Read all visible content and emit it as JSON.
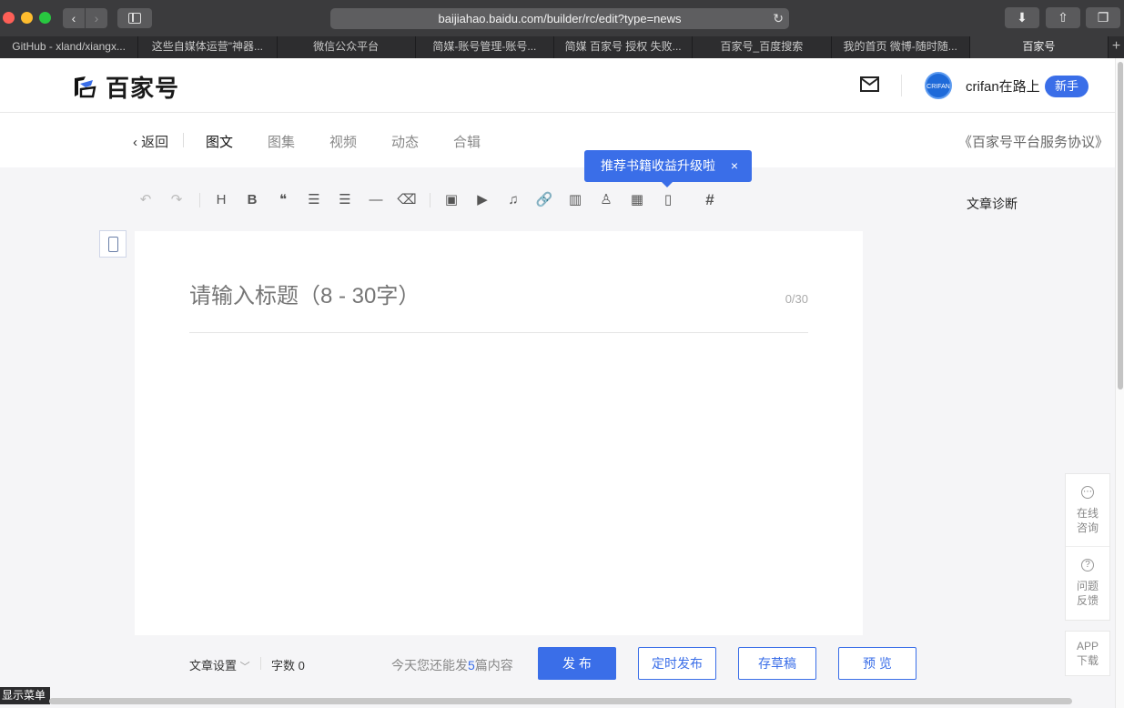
{
  "browser": {
    "url": "baijiahao.baidu.com/builder/rc/edit?type=news",
    "tabs": [
      {
        "label": "GitHub - xland/xiangx..."
      },
      {
        "label": "这些自媒体运营\"神器..."
      },
      {
        "label": "微信公众平台"
      },
      {
        "label": "简媒-账号管理-账号..."
      },
      {
        "label": "简媒 百家号 授权 失败..."
      },
      {
        "label": "百家号_百度搜索"
      },
      {
        "label": "我的首页 微博-随时随..."
      },
      {
        "label": "百家号"
      }
    ],
    "new_tab": "+"
  },
  "header": {
    "logo_text": "百家号",
    "username": "crifan在路上",
    "avatar_text": "CRIFAN",
    "newbie_badge": "新手"
  },
  "subnav": {
    "back": "返回",
    "tabs": [
      {
        "label": "图文"
      },
      {
        "label": "图集"
      },
      {
        "label": "视频"
      },
      {
        "label": "动态"
      },
      {
        "label": "合辑"
      }
    ],
    "agreement": "《百家号平台服务协议》"
  },
  "tooltip": {
    "text": "推荐书籍收益升级啦",
    "close": "×"
  },
  "toolbar": {
    "icons": [
      "undo-icon",
      "redo-icon",
      "heading-icon",
      "bold-icon",
      "quote-icon",
      "ordered-list-icon",
      "bullet-list-icon",
      "divider-icon",
      "clear-format-icon",
      "image-icon",
      "video-icon",
      "audio-icon",
      "link-icon",
      "chart-icon",
      "user-card-icon",
      "table-icon",
      "book-icon",
      "hashtag-icon"
    ],
    "glyphs": {
      "undo": "↶",
      "redo": "↷",
      "heading": "H",
      "bold": "B",
      "quote": "❝",
      "ordered": "☰",
      "bullet": "☰",
      "divider": "—",
      "eraser": "⌫",
      "image": "▣",
      "video": "▶",
      "audio": "♫",
      "link": "🔗",
      "chart": "▥",
      "person": "♙",
      "table": "▦",
      "book": "▯",
      "hash": "#"
    },
    "diagnosis": "文章诊断"
  },
  "editor": {
    "title_placeholder": "请输入标题（8 - 30字）",
    "title_count": "0/30"
  },
  "float_panel": {
    "chat_icon_glyph": "⋯",
    "chat_line1": "在线",
    "chat_line2": "咨询",
    "help_icon_glyph": "?",
    "help_line1": "问题",
    "help_line2": "反馈",
    "app_line1": "APP",
    "app_line2": "下载"
  },
  "bottombar": {
    "settings": "文章设置",
    "word_count": "字数 0",
    "quota_prefix": "今天您还能发",
    "quota_number": "5",
    "quota_suffix": "篇内容",
    "publish": "发 布",
    "schedule": "定时发布",
    "draft": "存草稿",
    "preview": "预 览"
  },
  "misc": {
    "show_menu": "显示菜单"
  },
  "colors": {
    "accent": "#3a6ee8",
    "titlebar": "#3b3b3d"
  }
}
